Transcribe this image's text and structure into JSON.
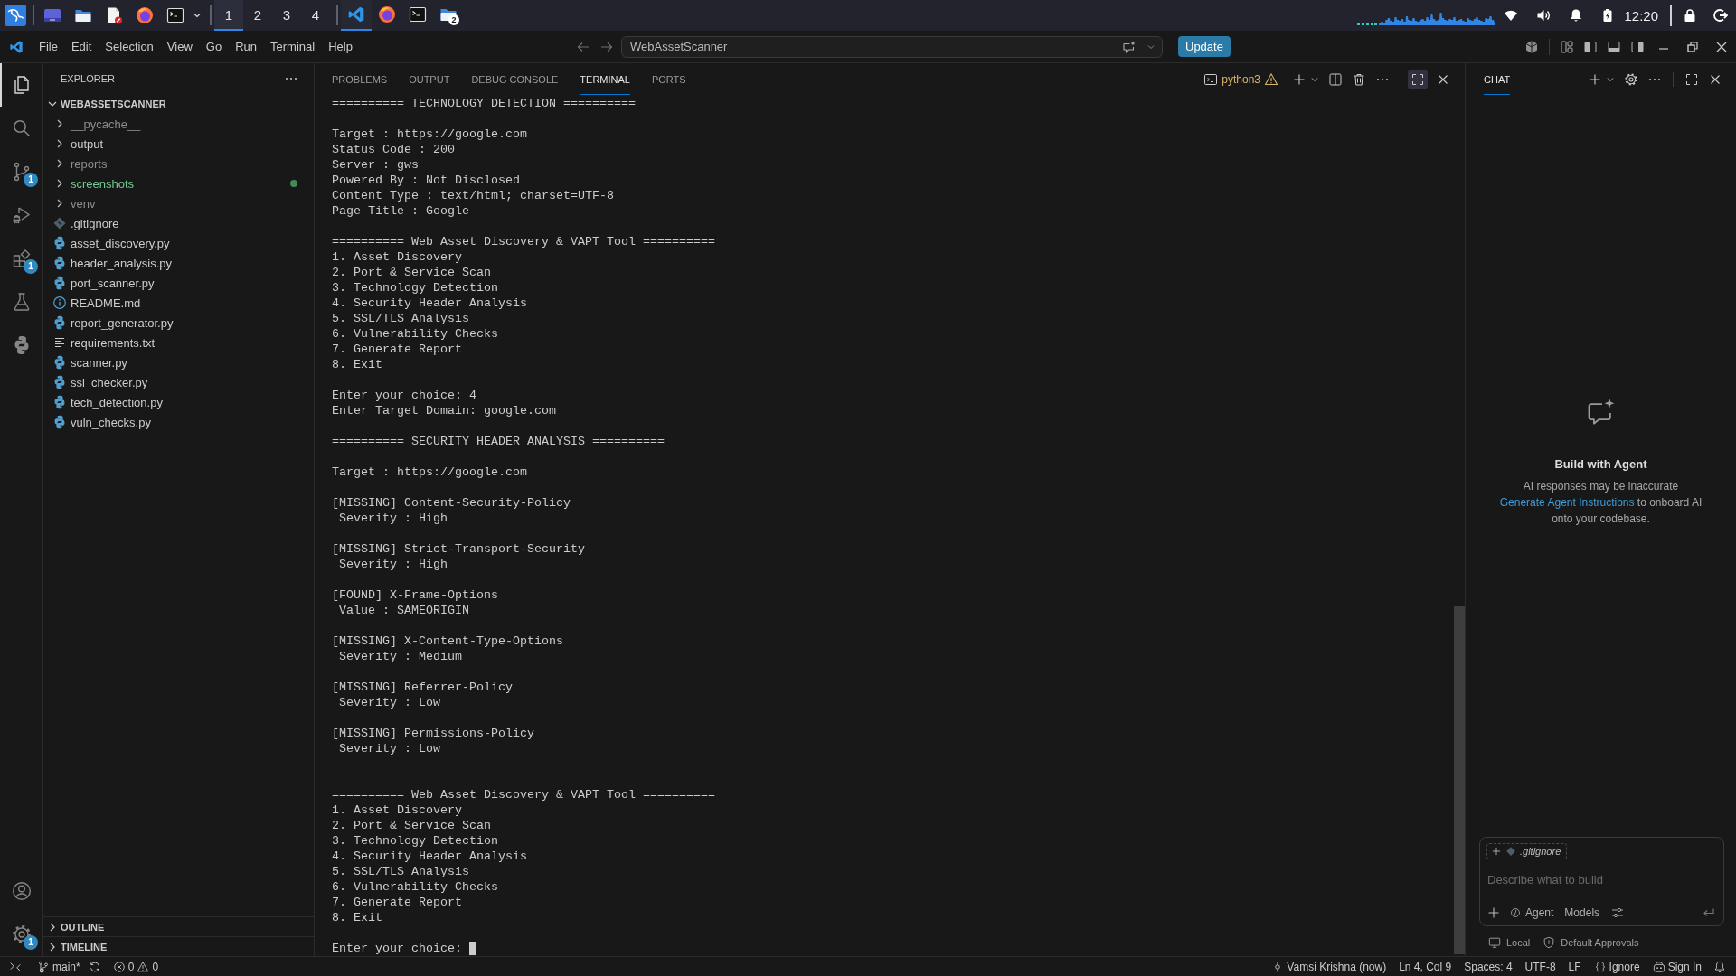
{
  "taskbar": {
    "workspaces": [
      {
        "label": "1",
        "selected": true
      },
      {
        "label": "2",
        "selected": false
      },
      {
        "label": "3",
        "selected": false
      },
      {
        "label": "4",
        "selected": false
      }
    ],
    "windows": [
      {
        "kind": "code",
        "selected": true
      },
      {
        "kind": "browser",
        "selected": false
      },
      {
        "kind": "terminal",
        "selected": false
      },
      {
        "kind": "files",
        "selected": false,
        "badge": "2"
      }
    ],
    "clock": "12:20"
  },
  "titlebar": {
    "menu": [
      "File",
      "Edit",
      "Selection",
      "View",
      "Go",
      "Run",
      "Terminal",
      "Help"
    ],
    "workspace": "WebAssetScanner",
    "update_button": "Update"
  },
  "activity_bar": {
    "items": [
      {
        "kind": "explorer",
        "selected": true
      },
      {
        "kind": "search",
        "selected": false
      },
      {
        "kind": "source_control",
        "selected": false,
        "badge": "1"
      },
      {
        "kind": "run_debug",
        "selected": false
      },
      {
        "kind": "extensions",
        "selected": false,
        "badge": "1"
      },
      {
        "kind": "testing",
        "selected": false
      },
      {
        "kind": "python",
        "selected": false
      }
    ],
    "bottom": [
      {
        "kind": "accounts"
      },
      {
        "kind": "settings",
        "badge": "1"
      }
    ]
  },
  "explorer": {
    "title": "EXPLORER",
    "root": {
      "label": "WEBASSETSCANNER",
      "expanded": true
    },
    "items": [
      {
        "name": "__pycache__",
        "kind": "folder",
        "expanded": false,
        "ignored": true,
        "untracked": false
      },
      {
        "name": "output",
        "kind": "folder",
        "expanded": false,
        "ignored": false,
        "untracked": false
      },
      {
        "name": "reports",
        "kind": "folder",
        "expanded": false,
        "ignored": true,
        "untracked": false
      },
      {
        "name": "screenshots",
        "kind": "folder",
        "expanded": false,
        "ignored": false,
        "untracked": true
      },
      {
        "name": "venv",
        "kind": "folder",
        "expanded": false,
        "ignored": true,
        "untracked": false
      },
      {
        "name": ".gitignore",
        "kind": "git",
        "ignored": false,
        "untracked": false
      },
      {
        "name": "asset_discovery.py",
        "kind": "python",
        "ignored": false,
        "untracked": false
      },
      {
        "name": "header_analysis.py",
        "kind": "python",
        "ignored": false,
        "untracked": false
      },
      {
        "name": "port_scanner.py",
        "kind": "python",
        "ignored": false,
        "untracked": false
      },
      {
        "name": "README.md",
        "kind": "info",
        "ignored": false,
        "untracked": false
      },
      {
        "name": "report_generator.py",
        "kind": "python",
        "ignored": false,
        "untracked": false
      },
      {
        "name": "requirements.txt",
        "kind": "text",
        "ignored": false,
        "untracked": false
      },
      {
        "name": "scanner.py",
        "kind": "python",
        "ignored": false,
        "untracked": false
      },
      {
        "name": "ssl_checker.py",
        "kind": "python",
        "ignored": false,
        "untracked": false
      },
      {
        "name": "tech_detection.py",
        "kind": "python",
        "ignored": false,
        "untracked": false
      },
      {
        "name": "vuln_checks.py",
        "kind": "python",
        "ignored": false,
        "untracked": false
      }
    ],
    "sections": [
      {
        "label": "OUTLINE",
        "expanded": false
      },
      {
        "label": "TIMELINE",
        "expanded": false
      }
    ]
  },
  "panel": {
    "tabs": [
      {
        "label": "PROBLEMS",
        "selected": false
      },
      {
        "label": "OUTPUT",
        "selected": false
      },
      {
        "label": "DEBUG CONSOLE",
        "selected": false
      },
      {
        "label": "TERMINAL",
        "selected": true
      },
      {
        "label": "PORTS",
        "selected": false
      }
    ],
    "terminal_name": "python3",
    "maximized": true,
    "output": [
      {
        "blocks": [
          {
            "lines": [
              "========== TECHNOLOGY DETECTION =========="
            ]
          },
          {
            "lines": [
              "Target : https://google.com",
              "Status Code : 200",
              "Server : gws",
              "Powered By : Not Disclosed",
              "Content Type : text/html; charset=UTF-8",
              "Page Title : Google"
            ]
          },
          {
            "lines": [
              "========== Web Asset Discovery & VAPT Tool ==========",
              "1. Asset Discovery",
              "2. Port & Service Scan",
              "3. Technology Detection",
              "4. Security Header Analysis",
              "5. SSL/TLS Analysis",
              "6. Vulnerability Checks",
              "7. Generate Report",
              "8. Exit"
            ]
          },
          {
            "lines": [
              "Enter your choice: 4",
              "Enter Target Domain: google.com"
            ]
          },
          {
            "lines": [
              "========== SECURITY HEADER ANALYSIS =========="
            ]
          },
          {
            "lines": [
              "Target : https://google.com"
            ]
          },
          {
            "lines": [
              "[MISSING] Content-Security-Policy",
              " Severity : High"
            ]
          },
          {
            "lines": [
              "[MISSING] Strict-Transport-Security",
              " Severity : High"
            ]
          },
          {
            "lines": [
              "[FOUND] X-Frame-Options",
              " Value : SAMEORIGIN"
            ]
          },
          {
            "lines": [
              "[MISSING] X-Content-Type-Options",
              " Severity : Medium"
            ]
          },
          {
            "lines": [
              "[MISSING] Referrer-Policy",
              " Severity : Low"
            ]
          },
          {
            "lines": [
              "[MISSING] Permissions-Policy",
              " Severity : Low"
            ]
          }
        ]
      },
      {
        "blocks": [
          {
            "lines": [
              "========== Web Asset Discovery & VAPT Tool ==========",
              "1. Asset Discovery",
              "2. Port & Service Scan",
              "3. Technology Detection",
              "4. Security Header Analysis",
              "5. SSL/TLS Analysis",
              "6. Vulnerability Checks",
              "7. Generate Report",
              "8. Exit"
            ]
          },
          {
            "lines": [
              "Enter your choice: "
            ]
          }
        ]
      }
    ],
    "cursor": true
  },
  "chat": {
    "tab": {
      "label": "CHAT",
      "selected": true
    },
    "heading": "Build with Agent",
    "disclaimer": "AI responses may be inaccurate",
    "link": "Generate Agent Instructions",
    "link_suffix": "to onboard AI onto your codebase.",
    "attachment": ".gitignore",
    "placeholder": "Describe what to build",
    "mode": "Agent",
    "models": "Models",
    "location": "Local",
    "approvals": "Default Approvals"
  },
  "status_bar": {
    "branch": "main*",
    "errors": "0",
    "warnings": "0",
    "items": [
      {
        "kind": "author",
        "label": "Vamsi Krishna (now)"
      },
      {
        "kind": "text",
        "label": "Ln 4, Col 9"
      },
      {
        "kind": "text",
        "label": "Spaces: 4"
      },
      {
        "kind": "text",
        "label": "UTF-8"
      },
      {
        "kind": "text",
        "label": "LF"
      },
      {
        "kind": "language",
        "label": "Ignore"
      },
      {
        "kind": "account",
        "label": "Sign In"
      }
    ]
  }
}
